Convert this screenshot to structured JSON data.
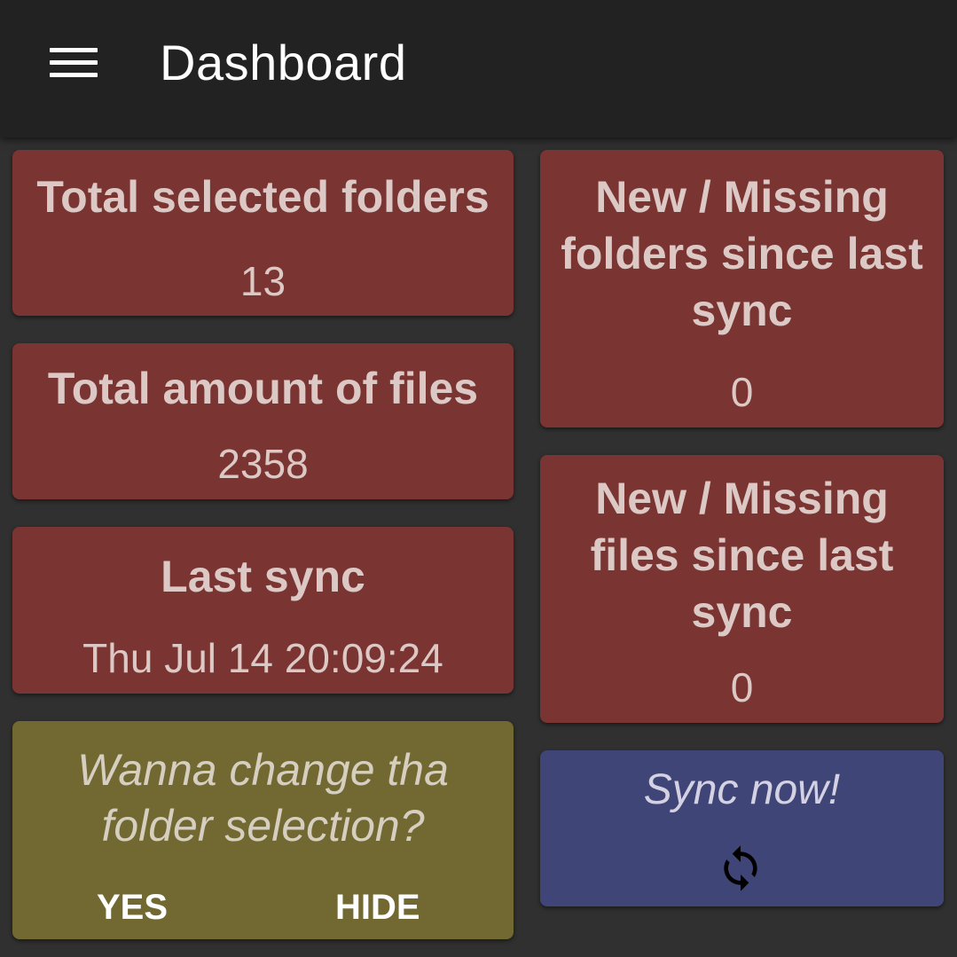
{
  "appbar": {
    "title": "Dashboard",
    "menu_icon": "hamburger-menu-icon"
  },
  "cards": {
    "selected_folders": {
      "title": "Total selected folders",
      "value": "13"
    },
    "total_files": {
      "title": "Total amount of files",
      "value": "2358"
    },
    "last_sync": {
      "title": "Last sync",
      "value": "Thu Jul 14 20:09:24"
    },
    "new_missing_folders": {
      "title_lines": [
        "New / Missing",
        "folders since last",
        "sync"
      ],
      "value": "0"
    },
    "new_missing_files": {
      "title_lines": [
        "New / Missing",
        "files since last",
        "sync"
      ],
      "value": "0"
    }
  },
  "folder_prompt": {
    "lines": [
      "Wanna change tha",
      "folder selection?"
    ],
    "yes_label": "YES",
    "hide_label": "HIDE"
  },
  "sync_button": {
    "label": "Sync now!",
    "icon": "sync-icon"
  },
  "colors": {
    "background": "#303030",
    "appbar": "#222222",
    "stat_card": "#7a3532",
    "prompt_card": "#716832",
    "sync_card": "#3f4577"
  }
}
